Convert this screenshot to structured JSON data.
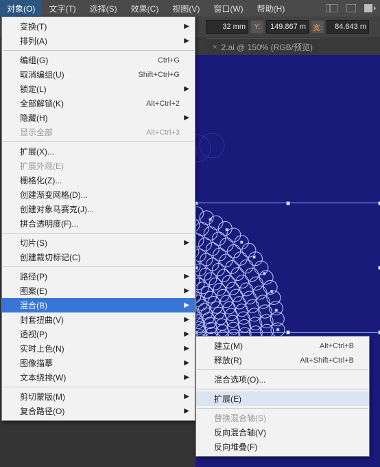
{
  "menubar": {
    "items": [
      "对象(O)",
      "文字(T)",
      "选择(S)",
      "效果(C)",
      "视图(V)",
      "窗口(W)",
      "帮助(H)"
    ]
  },
  "optbar": {
    "mm": "32 mm",
    "y_label": "Y:",
    "y_val": "149.867 m",
    "w_label": "宽:",
    "w_val": "84.643 m"
  },
  "tab": {
    "title": "2.ai @ 150% (RGB/预览)"
  },
  "main_menu": [
    {
      "t": "row",
      "label": "变换(T)",
      "sub": true
    },
    {
      "t": "row",
      "label": "排列(A)",
      "sub": true
    },
    {
      "t": "sep"
    },
    {
      "t": "row",
      "label": "编组(G)",
      "sc": "Ctrl+G"
    },
    {
      "t": "row",
      "label": "取消编组(U)",
      "sc": "Shift+Ctrl+G"
    },
    {
      "t": "row",
      "label": "锁定(L)",
      "sub": true
    },
    {
      "t": "row",
      "label": "全部解锁(K)",
      "sc": "Alt+Ctrl+2"
    },
    {
      "t": "row",
      "label": "隐藏(H)",
      "sub": true
    },
    {
      "t": "row",
      "label": "显示全部",
      "sc": "Alt+Ctrl+3",
      "dis": true
    },
    {
      "t": "sep"
    },
    {
      "t": "row",
      "label": "扩展(X)..."
    },
    {
      "t": "row",
      "label": "扩展外观(E)",
      "dis": true
    },
    {
      "t": "row",
      "label": "栅格化(Z)..."
    },
    {
      "t": "row",
      "label": "创建渐变网格(D)..."
    },
    {
      "t": "row",
      "label": "创建对象马赛克(J)..."
    },
    {
      "t": "row",
      "label": "拼合透明度(F)..."
    },
    {
      "t": "sep"
    },
    {
      "t": "row",
      "label": "切片(S)",
      "sub": true
    },
    {
      "t": "row",
      "label": "创建裁切标记(C)"
    },
    {
      "t": "sep"
    },
    {
      "t": "row",
      "label": "路径(P)",
      "sub": true
    },
    {
      "t": "row",
      "label": "图案(E)",
      "sub": true
    },
    {
      "t": "row",
      "label": "混合(B)",
      "sub": true,
      "hl": true
    },
    {
      "t": "row",
      "label": "封套扭曲(V)",
      "sub": true
    },
    {
      "t": "row",
      "label": "透视(P)",
      "sub": true
    },
    {
      "t": "row",
      "label": "实时上色(N)",
      "sub": true
    },
    {
      "t": "row",
      "label": "图像描摹",
      "sub": true
    },
    {
      "t": "row",
      "label": "文本绕排(W)",
      "sub": true
    },
    {
      "t": "sep"
    },
    {
      "t": "row",
      "label": "剪切蒙版(M)",
      "sub": true
    },
    {
      "t": "row",
      "label": "复合路径(O)",
      "sub": true
    }
  ],
  "sub_menu": [
    {
      "t": "row",
      "label": "建立(M)",
      "sc": "Alt+Ctrl+B"
    },
    {
      "t": "row",
      "label": "释放(R)",
      "sc": "Alt+Shift+Ctrl+B"
    },
    {
      "t": "sep"
    },
    {
      "t": "row",
      "label": "混合选项(O)..."
    },
    {
      "t": "sep"
    },
    {
      "t": "row",
      "label": "扩展(E)",
      "hov": true
    },
    {
      "t": "sep"
    },
    {
      "t": "row",
      "label": "替换混合轴(S)",
      "dis": true
    },
    {
      "t": "row",
      "label": "反向混合轴(V)"
    },
    {
      "t": "row",
      "label": "反向堆叠(F)"
    }
  ]
}
